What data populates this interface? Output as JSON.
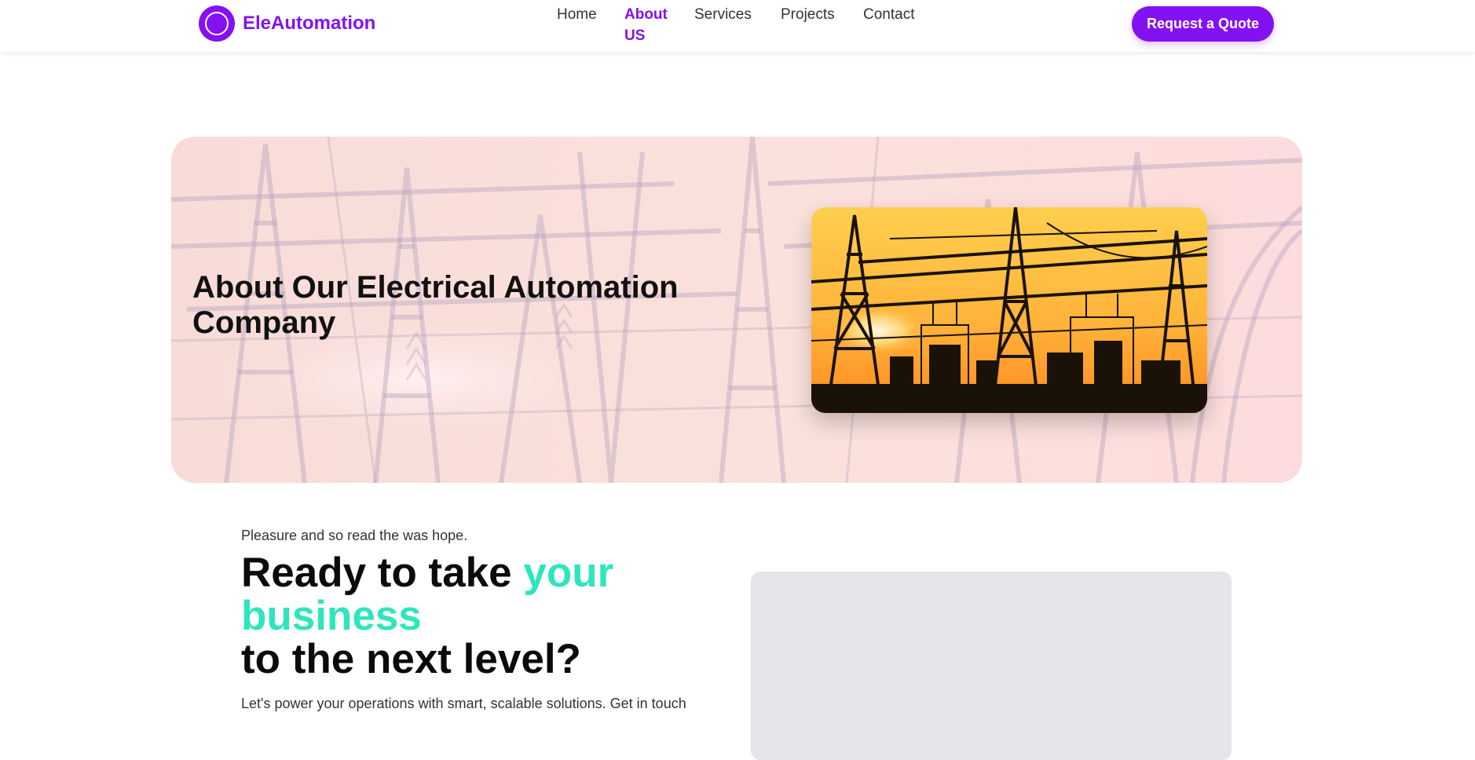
{
  "header": {
    "brand": "EleAutomation",
    "nav": [
      {
        "label": "Home",
        "active": false
      },
      {
        "label": "About US",
        "active": true
      },
      {
        "label": "Services",
        "active": false
      },
      {
        "label": "Projects",
        "active": false
      },
      {
        "label": "Contact",
        "active": false
      }
    ],
    "cta_label": "Request a Quote"
  },
  "hero": {
    "title": "About Our Electrical Automation Company"
  },
  "cta_section": {
    "eyebrow": "Pleasure and so read the was hope.",
    "heading_part1": "Ready to take ",
    "heading_accent": "your business",
    "heading_part2": "to the next level?",
    "body": "Let's power your operations with smart, scalable solutions. Get in touch"
  },
  "colors": {
    "brand": "#8411f2",
    "accent": "#2ee6bd",
    "hero_bg": "#fbe1dc",
    "placeholder": "#e5e6ea"
  }
}
